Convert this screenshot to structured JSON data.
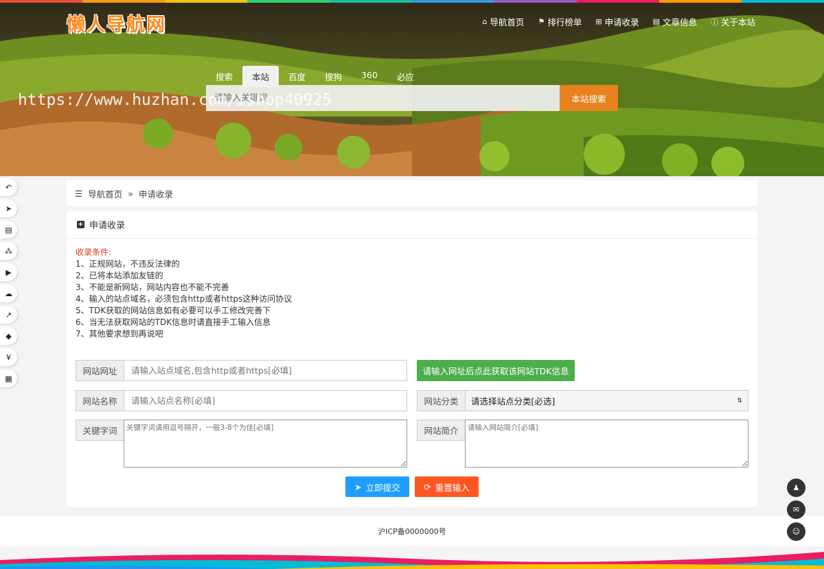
{
  "brand": {
    "logo_text": "懒人导航网"
  },
  "nav": {
    "items": [
      {
        "icon": "home-icon",
        "glyph": "⌂",
        "label": "导航首页"
      },
      {
        "icon": "flag-icon",
        "glyph": "⚑",
        "label": "排行榜单"
      },
      {
        "icon": "plus-square-icon",
        "glyph": "⊞",
        "label": "申请收录"
      },
      {
        "icon": "book-icon",
        "glyph": "▤",
        "label": "文章信息"
      },
      {
        "icon": "info-icon",
        "glyph": "ⓘ",
        "label": "关于本站"
      }
    ]
  },
  "search": {
    "tabs": [
      "搜索",
      "本站",
      "百度",
      "搜狗",
      "360",
      "必应"
    ],
    "active_tab": "本站",
    "placeholder": "请输入关键词",
    "button": "本站搜索"
  },
  "watermark": "https://www.huzhan.com/ishop40925",
  "dock": {
    "items": [
      {
        "icon": "reply-icon",
        "glyph": "↶"
      },
      {
        "icon": "send-icon",
        "glyph": "➤"
      },
      {
        "icon": "file-icon",
        "glyph": "▤"
      },
      {
        "icon": "cubes-icon",
        "glyph": "⁂"
      },
      {
        "icon": "youtube-icon",
        "glyph": "▶"
      },
      {
        "icon": "cloud-icon",
        "glyph": "☁"
      },
      {
        "icon": "line-chart-icon",
        "glyph": "↗"
      },
      {
        "icon": "graduation-cap-icon",
        "glyph": "◆"
      },
      {
        "icon": "yen-icon",
        "glyph": "¥"
      },
      {
        "icon": "grid-icon",
        "glyph": "▦"
      }
    ]
  },
  "breadcrumb": {
    "icon": "sliders-icon",
    "glyph": "☰",
    "home": "导航首页",
    "sep": "»",
    "current": "申请收录"
  },
  "panel": {
    "title": "申请收录",
    "rules_title": "收录条件:",
    "rules": [
      "1、正规网站，不违反法律的",
      "2、已将本站添加友链的",
      "3、不能是新网站，网站内容也不能不完善",
      "4、输入的站点域名，必须包含http或者https这种访问协议",
      "5、TDK获取的网站信息如有必要可以手工修改完善下",
      "6、当无法获取网站的TDK信息时请直接手工输入信息",
      "7、其他要求想到再说吧"
    ]
  },
  "form": {
    "url_label": "网站网址",
    "url_placeholder": "请输入站点域名,包含http或者https[必填]",
    "tdk_button": "请输入网址后点此获取该网站TDK信息",
    "name_label": "网站名称",
    "name_placeholder": "请输入站点名称[必填]",
    "category_label": "网站分类",
    "category_value": "请选择站点分类[必选]",
    "keywords_label": "关键字词",
    "keywords_placeholder": "关键字词请用逗号隔开，一般3-8个为佳[必填]",
    "desc_label": "网站简介",
    "desc_placeholder": "请输入网站简介[必填]",
    "submit": "立即提交",
    "reset": "重置输入"
  },
  "footer": {
    "icp": "沪ICP备0000000号"
  },
  "float": {
    "items": [
      {
        "icon": "qq-icon",
        "glyph": "♟"
      },
      {
        "icon": "envelope-icon",
        "glyph": "✉"
      },
      {
        "icon": "wechat-icon",
        "glyph": "☺"
      }
    ]
  },
  "colors": {
    "accent": "#e8821e",
    "green": "#4cae4c",
    "blue": "#1e9fff",
    "orange": "#ff5722",
    "rule_title": "#e03a1f"
  }
}
